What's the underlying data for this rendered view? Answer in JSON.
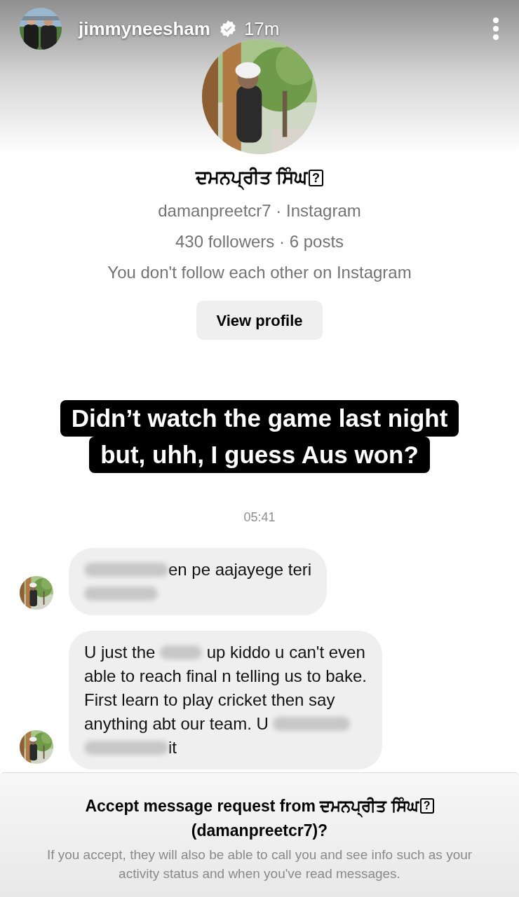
{
  "story_header": {
    "username": "jimmyneesham",
    "verified": true,
    "time": "17m"
  },
  "profile": {
    "name": "ਦਮਨਪ੍ਰੀਤ ਸਿੰਘ",
    "name_mark": "?",
    "handle_line": "damanpreetcr7 · Instagram",
    "stats": "430 followers · 6 posts",
    "relation": "You don't follow each other on Instagram",
    "button": "View profile"
  },
  "caption": [
    "Didn’t watch the game last night",
    "but, uhh, I guess Aus won?"
  ],
  "timestamp": "05:41",
  "messages": [
    {
      "lines": [
        [
          {
            "kind": "blur"
          },
          {
            "kind": "text",
            "text": "en pe aajayege teri"
          }
        ],
        [
          {
            "kind": "blur"
          }
        ]
      ]
    },
    {
      "lines": [
        [
          {
            "kind": "text",
            "text": "U just the "
          },
          {
            "kind": "blur"
          },
          {
            "kind": "text",
            "text": " up kiddo u can't even"
          }
        ],
        [
          {
            "kind": "text",
            "text": "able to reach final n telling us to bake."
          }
        ],
        [
          {
            "kind": "text",
            "text": "First learn to play cricket then say"
          }
        ],
        [
          {
            "kind": "text",
            "text": "anything abt our team. U "
          },
          {
            "kind": "blur"
          }
        ],
        [
          {
            "kind": "blur"
          },
          {
            "kind": "text",
            "text": "it"
          }
        ]
      ]
    }
  ],
  "request": {
    "title": "Accept message request from",
    "name": "ਦਮਨਪ੍ਰੀਤ ਸਿੰਘ",
    "name_mark": "?",
    "handle": "(damanpreetcr7)?",
    "body": "If you accept, they will also be able to call you and see info such as your activity status and when you've read messages."
  }
}
